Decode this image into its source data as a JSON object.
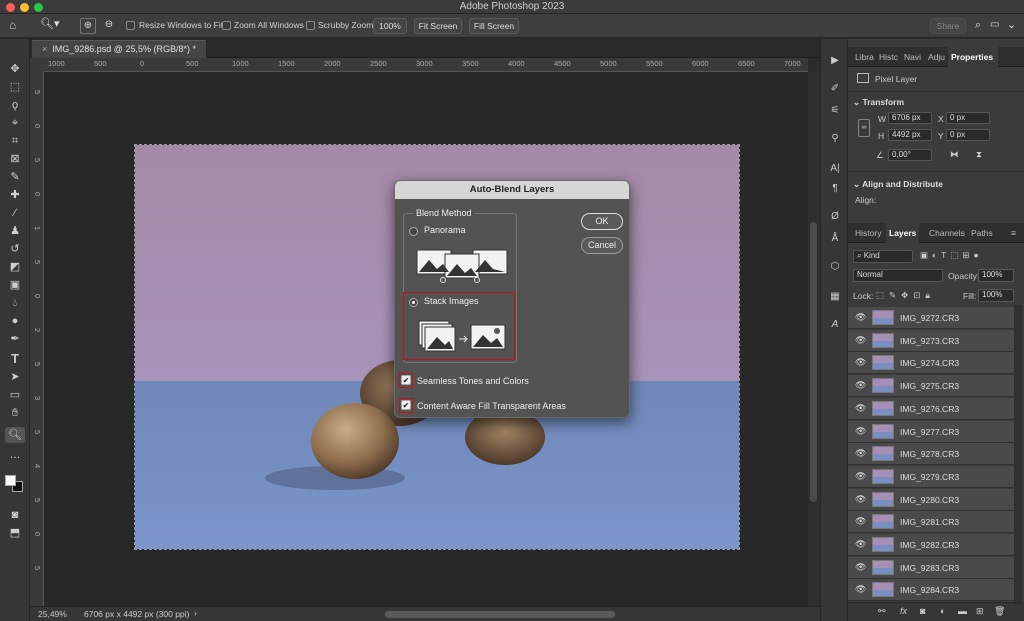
{
  "app": {
    "title": "Adobe Photoshop 2023"
  },
  "options_bar": {
    "resize_windows_to_fit": "Resize Windows to Fit",
    "zoom_all_windows": "Zoom All Windows",
    "scrubby_zoom": "Scrubby Zoom",
    "zoom_percent": "100%",
    "fit_screen": "Fit Screen",
    "fill_screen": "Fill Screen",
    "share": "Share"
  },
  "document": {
    "tab_label": "IMG_9286.psd @ 25,5% (RGB/8*) *",
    "ruler_h": [
      "1000",
      "500",
      "0",
      "500",
      "1000",
      "1500",
      "2000",
      "2500",
      "3000",
      "3500",
      "4000",
      "4500",
      "5000",
      "5500",
      "6000",
      "6500",
      "7000",
      "7500"
    ],
    "ruler_v": [
      "5",
      "0",
      "5",
      "0",
      "1",
      "5",
      "0",
      "2",
      "5",
      "3",
      "5",
      "4",
      "5",
      "0",
      "5"
    ]
  },
  "status": {
    "zoom": "25,49%",
    "doc_info": "6706 px x 4492 px (300 ppi)",
    "arrow": "›"
  },
  "properties_panel": {
    "tabs": [
      "Libra",
      "Histc",
      "Navi",
      "Adju",
      "Properties"
    ],
    "kind": "Pixel Layer",
    "transform_title": "Transform",
    "w_label": "W",
    "w_value": "6706 px",
    "h_label": "H",
    "h_value": "4492 px",
    "x_label": "X",
    "x_value": "0 px",
    "y_label": "Y",
    "y_value": "0 px",
    "angle": "0,00°",
    "align_title": "Align and Distribute",
    "align_label": "Align:"
  },
  "layers_panel": {
    "tabs": [
      "History",
      "Layers",
      "Channels",
      "Paths"
    ],
    "filter_kind": "Kind",
    "blend_mode": "Normal",
    "opacity_label": "Opacity:",
    "opacity_value": "100%",
    "lock_label": "Lock:",
    "fill_label": "Fill:",
    "fill_value": "100%",
    "layers": [
      "IMG_9272.CR3",
      "IMG_9273.CR3",
      "IMG_9274.CR3",
      "IMG_9275.CR3",
      "IMG_9276.CR3",
      "IMG_9277.CR3",
      "IMG_9278.CR3",
      "IMG_9279.CR3",
      "IMG_9280.CR3",
      "IMG_9281.CR3",
      "IMG_9282.CR3",
      "IMG_9283.CR3",
      "IMG_9284.CR3"
    ]
  },
  "dialog": {
    "title": "Auto-Blend Layers",
    "group_label": "Blend Method",
    "panorama": "Panorama",
    "stack_images": "Stack Images",
    "selected_method": "Stack Images",
    "ok": "OK",
    "cancel": "Cancel",
    "seamless": "Seamless Tones and Colors",
    "seamless_checked": true,
    "content_aware": "Content Aware Fill Transparent Areas",
    "content_aware_checked": true
  },
  "colors": {
    "accent_red": "#c0141c",
    "wall": "#a68fb4",
    "table": "#7a8fc0"
  }
}
